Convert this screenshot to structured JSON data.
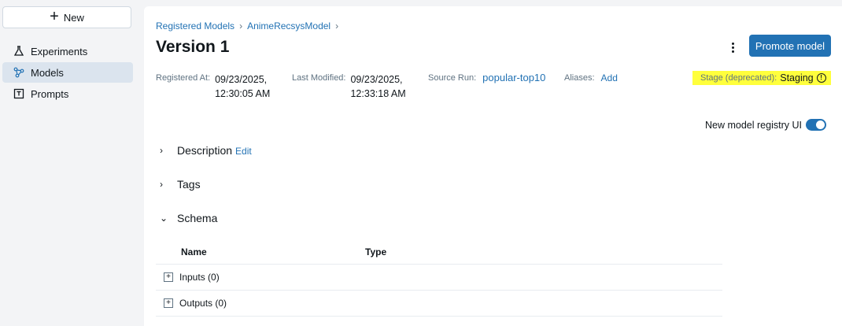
{
  "sidebar": {
    "new_label": "New",
    "items": [
      {
        "label": "Experiments",
        "icon": "flask-icon"
      },
      {
        "label": "Models",
        "icon": "models-icon"
      },
      {
        "label": "Prompts",
        "icon": "prompts-icon"
      }
    ]
  },
  "breadcrumb": [
    "Registered Models",
    "AnimeRecsysModel"
  ],
  "header": {
    "title": "Version 1",
    "promote_label": "Promote model"
  },
  "meta": {
    "registered_at_key": "Registered At:",
    "registered_at_date": "09/23/2025,",
    "registered_at_time": "12:30:05 AM",
    "last_modified_key": "Last Modified:",
    "last_modified_date": "09/23/2025,",
    "last_modified_time": "12:33:18 AM",
    "source_run_key": "Source Run:",
    "source_run_value": "popular-top10",
    "aliases_key": "Aliases:",
    "aliases_value": "Add",
    "stage_key": "Stage (deprecated):",
    "stage_value": "Staging",
    "stage_icon": "info-icon"
  },
  "toggle": {
    "label": "New model registry UI",
    "on": true
  },
  "sections": {
    "description": "Description",
    "description_edit": "Edit",
    "tags": "Tags",
    "schema": "Schema"
  },
  "schema_table": {
    "columns": [
      "Name",
      "Type"
    ],
    "rows": [
      "Inputs (0)",
      "Outputs (0)"
    ]
  },
  "colors": {
    "accent": "#2272b4",
    "highlight": "#ffff3c"
  }
}
